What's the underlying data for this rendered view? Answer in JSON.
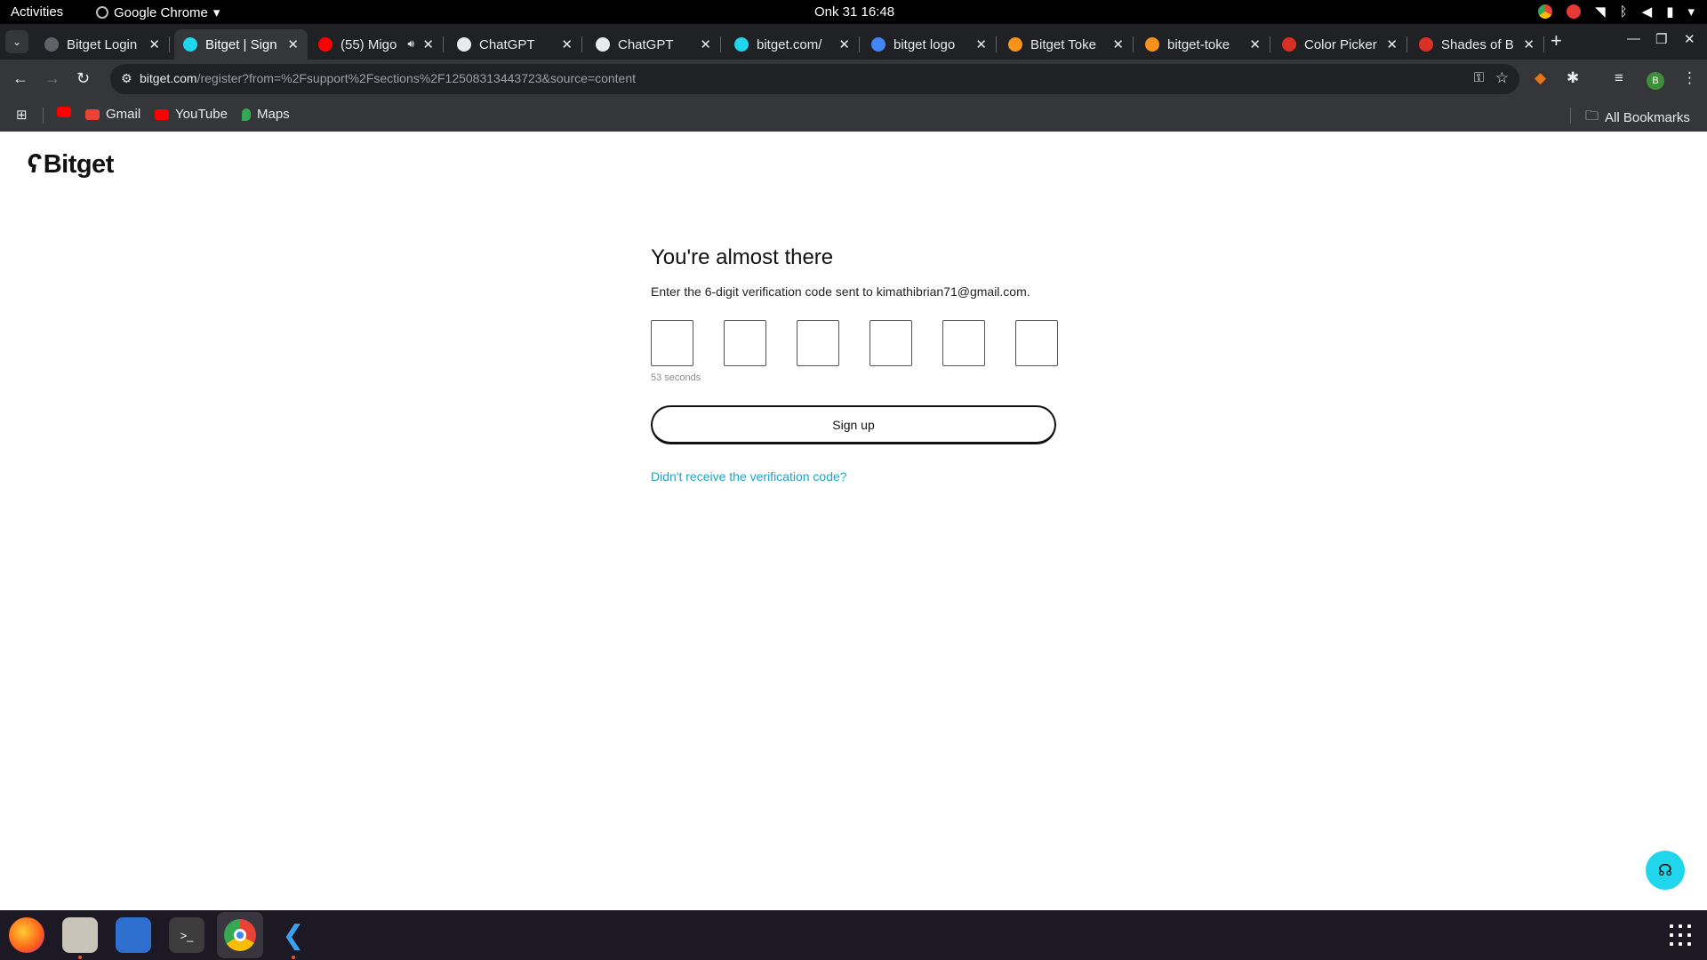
{
  "topbar": {
    "activities": "Activities",
    "app_name": "Google Chrome",
    "clock": "Onk 31  16:48"
  },
  "tabs": [
    {
      "title": "Bitget Login",
      "favicon": "globe-icon",
      "color": "#5f6368",
      "active": false
    },
    {
      "title": "Bitget | Sign",
      "favicon": "bitget-icon",
      "color": "#1fd6ec",
      "active": true
    },
    {
      "title": "(55) Migo",
      "favicon": "youtube-icon",
      "color": "#ff0000",
      "active": false,
      "audio": true
    },
    {
      "title": "ChatGPT",
      "favicon": "chatgpt-icon",
      "color": "#e8eaed",
      "active": false
    },
    {
      "title": "ChatGPT",
      "favicon": "chatgpt-icon",
      "color": "#e8eaed",
      "active": false
    },
    {
      "title": "bitget.com/",
      "favicon": "bitget-icon",
      "color": "#1fd6ec",
      "active": false
    },
    {
      "title": "bitget logo",
      "favicon": "google-icon",
      "color": "#4285f4",
      "active": false
    },
    {
      "title": "Bitget Toke",
      "favicon": "coin-icon",
      "color": "#f7931a",
      "active": false
    },
    {
      "title": "bitget-toke",
      "favicon": "coin-icon",
      "color": "#f7931a",
      "active": false
    },
    {
      "title": "Color Picker",
      "favicon": "colorpicker-icon",
      "color": "#d93025",
      "active": false
    },
    {
      "title": "Shades of B",
      "favicon": "shades-icon",
      "color": "#d93025",
      "active": false
    }
  ],
  "omnibox": {
    "host": "bitget.com",
    "path": "/register?from=%2Fsupport%2Fsections%2F12508313443723&source=content"
  },
  "bookmarks": {
    "items": [
      {
        "label": "",
        "icon": "youtube-icon",
        "color": "#ff0000"
      },
      {
        "label": "Gmail",
        "icon": "gmail-icon",
        "color": "#ea4335"
      },
      {
        "label": "YouTube",
        "icon": "youtube-icon",
        "color": "#ff0000"
      },
      {
        "label": "Maps",
        "icon": "maps-icon",
        "color": "#34a853"
      }
    ],
    "all_bookmarks": "All Bookmarks"
  },
  "account_initial": "B",
  "page": {
    "logo_text": "Bitget",
    "heading": "You're almost there",
    "subtext": "Enter the 6-digit verification code sent to kimathibrian71@gmail.com.",
    "code_digits": [
      "",
      "",
      "",
      "",
      "",
      ""
    ],
    "timer": "53 seconds",
    "signup_label": "Sign up",
    "resend_label": "Didn't receive the verification code?"
  },
  "colors": {
    "accent": "#1fd6ec",
    "link": "#1ba3c9"
  }
}
